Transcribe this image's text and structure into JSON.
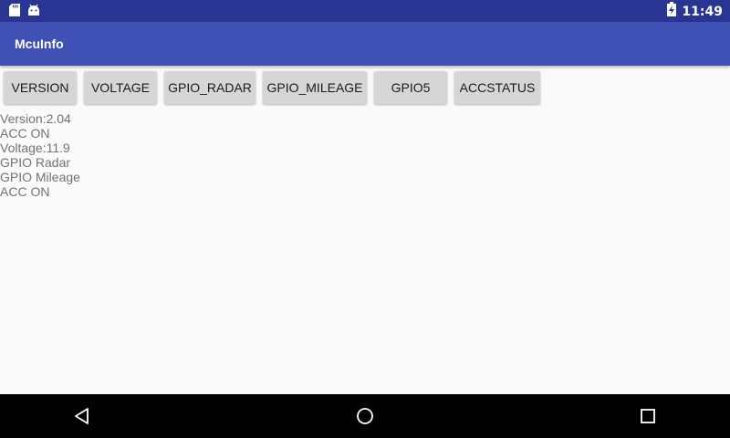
{
  "status_bar": {
    "time": "11:49",
    "left_icons": [
      "sd-card-icon",
      "android-icon"
    ],
    "right_icons": [
      "battery-charging-icon"
    ]
  },
  "app_bar": {
    "title": "McuInfo",
    "color": "#3f51b5"
  },
  "buttons": [
    {
      "label": "VERSION"
    },
    {
      "label": "VOLTAGE"
    },
    {
      "label": "GPIO_RADAR"
    },
    {
      "label": "GPIO_MILEAGE"
    },
    {
      "label": "GPIO5"
    },
    {
      "label": "ACCSTATUS"
    }
  ],
  "log_lines": [
    "Version:2.04",
    "ACC ON",
    "Voltage:11.9",
    "GPIO Radar",
    "GPIO Mileage",
    "ACC ON"
  ],
  "nav_bar": {
    "icons": [
      "back-icon",
      "home-icon",
      "recents-icon"
    ]
  }
}
